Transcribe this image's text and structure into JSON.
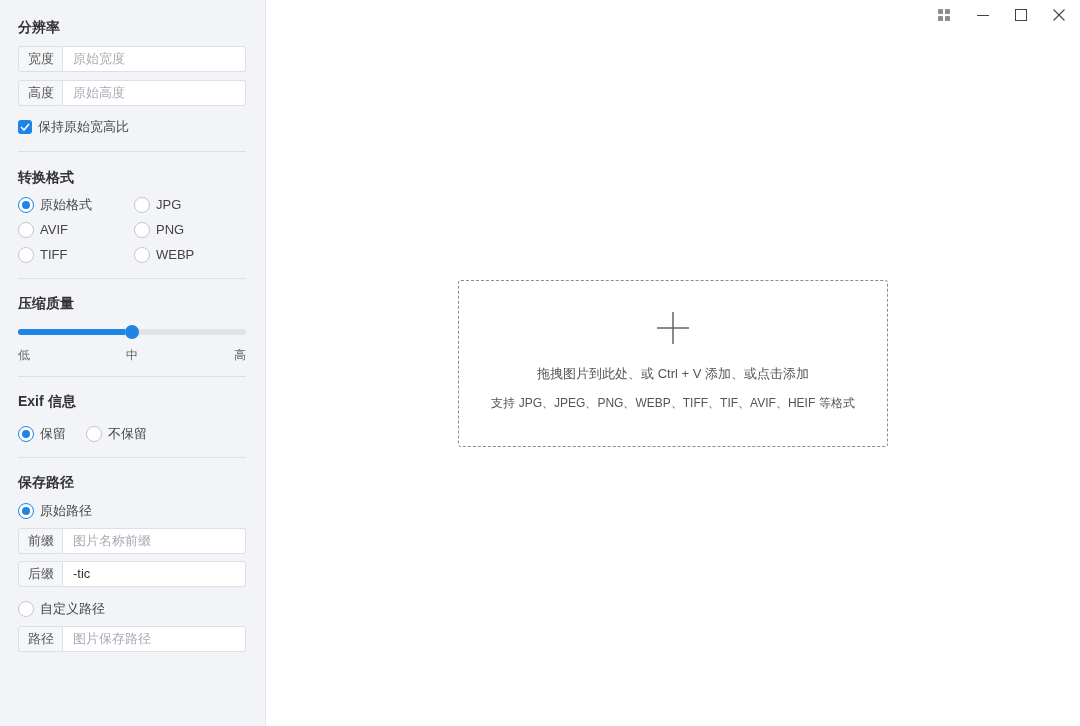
{
  "resolution": {
    "title": "分辨率",
    "fields": [
      {
        "label": "宽度",
        "placeholder": "原始宽度"
      },
      {
        "label": "高度",
        "placeholder": "原始高度"
      }
    ],
    "keep_ratio": {
      "label": "保持原始宽高比",
      "checked": true
    }
  },
  "format": {
    "title": "转换格式",
    "options": [
      {
        "label": "原始格式",
        "selected": true
      },
      {
        "label": "JPG",
        "selected": false
      },
      {
        "label": "AVIF",
        "selected": false
      },
      {
        "label": "PNG",
        "selected": false
      },
      {
        "label": "TIFF",
        "selected": false
      },
      {
        "label": "WEBP",
        "selected": false
      }
    ]
  },
  "quality": {
    "title": "压缩质量",
    "level": 0.5,
    "scale_labels": [
      "低",
      "中",
      "高"
    ]
  },
  "exif": {
    "title": "Exif 信息",
    "options": [
      {
        "label": "保留",
        "selected": true
      },
      {
        "label": "不保留",
        "selected": false
      }
    ]
  },
  "save_path": {
    "title": "保存路径",
    "options": [
      {
        "label": "原始路径",
        "selected": true,
        "fields": [
          {
            "label": "前缀",
            "placeholder": "图片名称前缀"
          },
          {
            "label": "后缀",
            "value": "-tic"
          }
        ]
      },
      {
        "label": "自定义路径",
        "selected": false,
        "fields": [
          {
            "label": "路径",
            "placeholder": "图片保存路径"
          }
        ]
      }
    ]
  },
  "drop_zone": {
    "instruction": "拖拽图片到此处、或 Ctrl + V 添加、或点击添加",
    "formats": "支持 JPG、JPEG、PNG、WEBP、TIFF、TIF、AVIF、HEIF 等格式"
  }
}
